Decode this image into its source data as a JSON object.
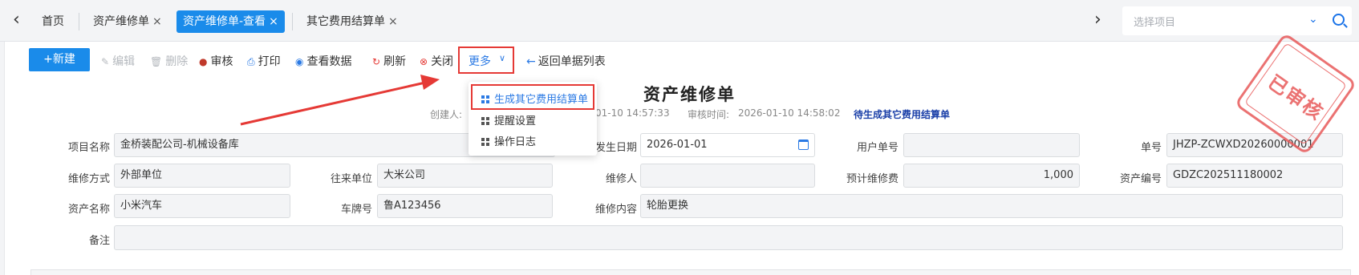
{
  "tabs": {
    "prev_arrow": "‹",
    "next_arrow": "›",
    "items": [
      {
        "label": "首页",
        "close": ""
      },
      {
        "label": "资产维修单",
        "close": "×"
      },
      {
        "label": "资产维修单-查看",
        "close": "×"
      },
      {
        "label": "其它费用结算单",
        "close": "×"
      }
    ],
    "project_select": {
      "placeholder": "选择项目"
    }
  },
  "toolbar": {
    "new": "+新建",
    "edit": "编辑",
    "delete": "删除",
    "audit": "审核",
    "print": "打印",
    "view_data": "查看数据",
    "refresh": "刷新",
    "close": "关闭",
    "more": "更多",
    "back": "返回单据列表"
  },
  "more_menu": {
    "items": [
      "生成其它费用结算单",
      "提醒设置",
      "操作日志"
    ]
  },
  "document": {
    "title": "资产维修单",
    "creator_label": "创建人:",
    "create_time_partial": "01-10 14:57:33",
    "audit_time_label": "审核时间:",
    "audit_time": "2026-01-10 14:58:02",
    "status": "待生成其它费用结算单"
  },
  "stamp": {
    "text": "已审核"
  },
  "form": {
    "project_name": {
      "label": "项目名称",
      "value": "金桥装配公司-机械设备库"
    },
    "occur_date": {
      "label": "发生日期",
      "value": "2026-01-01"
    },
    "user_no": {
      "label": "用户单号",
      "value": ""
    },
    "doc_no": {
      "label": "单号",
      "value": "JHZP-ZCWXD20260000001"
    },
    "repair_method": {
      "label": "维修方式",
      "value": "外部单位"
    },
    "partner": {
      "label": "往来单位",
      "value": "大米公司"
    },
    "repairer": {
      "label": "维修人",
      "value": ""
    },
    "est_cost": {
      "label": "预计维修费",
      "value": "1,000"
    },
    "asset_no": {
      "label": "资产编号",
      "value": "GDZC202511180002"
    },
    "asset_name": {
      "label": "资产名称",
      "value": "小米汽车"
    },
    "plate_no": {
      "label": "车牌号",
      "value": "鲁A123456"
    },
    "repair_content": {
      "label": "维修内容",
      "value": "轮胎更换"
    },
    "remark": {
      "label": "备注",
      "value": ""
    }
  },
  "colors": {
    "primary": "#1a8bea",
    "link": "#2b7ae4",
    "highlight": "#e53935",
    "stamp": "#e85a5a",
    "status": "#1a3fa8"
  }
}
